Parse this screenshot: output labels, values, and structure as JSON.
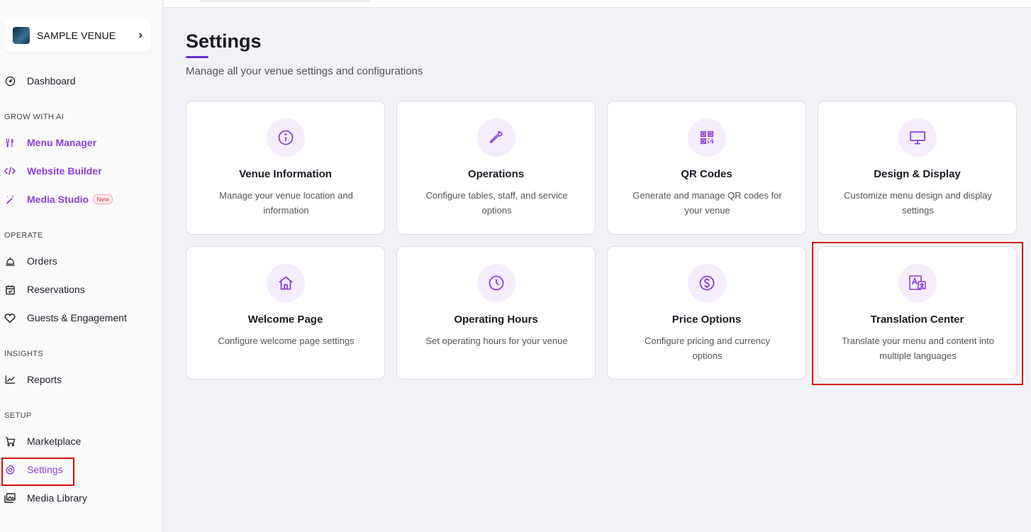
{
  "venue": {
    "name": "SAMPLE VENUE",
    "chevron": "›"
  },
  "sidebar": {
    "dashboard": "Dashboard",
    "sections": {
      "grow": "GROW WITH AI",
      "operate": "OPERATE",
      "insights": "INSIGHTS",
      "setup": "SETUP"
    },
    "items": {
      "menu_manager": "Menu Manager",
      "website_builder": "Website Builder",
      "media_studio": "Media Studio",
      "media_studio_badge": "New",
      "orders": "Orders",
      "reservations": "Reservations",
      "guests": "Guests & Engagement",
      "reports": "Reports",
      "marketplace": "Marketplace",
      "settings": "Settings",
      "media_library": "Media Library"
    },
    "icons": [
      "dashboard-icon",
      "utensils-icon",
      "code-icon",
      "magic-wand-icon",
      "bell-icon",
      "calendar-check-icon",
      "heart-icon",
      "chart-line-icon",
      "cart-icon",
      "gear-icon",
      "images-icon"
    ]
  },
  "page": {
    "title": "Settings",
    "subtitle": "Manage all your venue settings and configurations"
  },
  "cards": [
    {
      "title": "Venue Information",
      "desc": "Manage your venue location and information",
      "icon": "info-icon"
    },
    {
      "title": "Operations",
      "desc": "Configure tables, staff, and service options",
      "icon": "wrench-icon"
    },
    {
      "title": "QR Codes",
      "desc": "Generate and manage QR codes for your venue",
      "icon": "qr-code-icon"
    },
    {
      "title": "Design & Display",
      "desc": "Customize menu design and display settings",
      "icon": "monitor-icon"
    },
    {
      "title": "Welcome Page",
      "desc": "Configure welcome page settings",
      "icon": "home-icon"
    },
    {
      "title": "Operating Hours",
      "desc": "Set operating hours for your venue",
      "icon": "clock-icon"
    },
    {
      "title": "Price Options",
      "desc": "Configure pricing and currency options",
      "icon": "dollar-icon"
    },
    {
      "title": "Translation Center",
      "desc": "Translate your menu and content into multiple languages",
      "icon": "translate-icon"
    }
  ],
  "colors": {
    "accent": "#8b3fd9",
    "highlight": "#d51010",
    "icon_bg": "#f5edfc"
  }
}
